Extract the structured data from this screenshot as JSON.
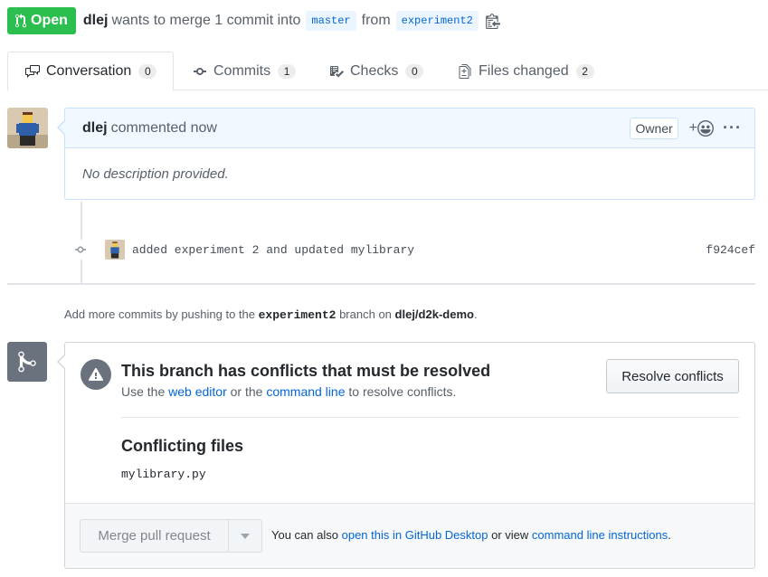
{
  "header": {
    "state": "Open",
    "author": "dlej",
    "action_text": "wants to merge 1 commit into",
    "base_branch": "master",
    "from_text": "from",
    "head_branch": "experiment2"
  },
  "tabs": [
    {
      "label": "Conversation",
      "count": "0"
    },
    {
      "label": "Commits",
      "count": "1"
    },
    {
      "label": "Checks",
      "count": "0"
    },
    {
      "label": "Files changed",
      "count": "2"
    }
  ],
  "comment": {
    "author": "dlej",
    "time_text": "commented now",
    "role_badge": "Owner",
    "reaction_plus": "+",
    "more": "···",
    "body": "No description provided."
  },
  "commit": {
    "message": "added experiment 2 and updated mylibrary",
    "sha": "f924cef"
  },
  "push_hint": {
    "prefix": "Add more commits by pushing to the",
    "branch": "experiment2",
    "middle": "branch on",
    "repo": "dlej/d2k-demo",
    "suffix": "."
  },
  "merge_box": {
    "title": "This branch has conflicts that must be resolved",
    "sub_prefix": "Use the",
    "web_editor_link": "web editor",
    "sub_or": "or the",
    "command_line_link": "command line",
    "sub_suffix": "to resolve conflicts.",
    "resolve_button": "Resolve conflicts",
    "conflicting_title": "Conflicting files",
    "conflicting_files": [
      "mylibrary.py"
    ],
    "merge_button": "Merge pull request",
    "foot_prefix": "You can also",
    "desktop_link": "open this in GitHub Desktop",
    "foot_or": "or view",
    "instructions_link": "command line instructions",
    "foot_suffix": "."
  },
  "colors": {
    "open_green": "#2cbe4e",
    "link_blue": "#0366d6",
    "comment_header_bg": "#f1f8ff",
    "merge_icon_gray": "#6a737d"
  }
}
